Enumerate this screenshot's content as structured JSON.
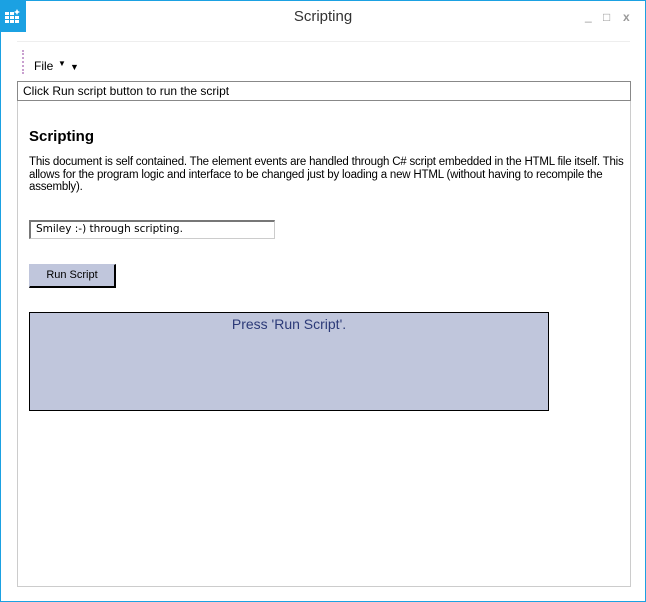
{
  "window": {
    "title": "Scripting",
    "minimize": "_",
    "maximize": "□",
    "close": "x"
  },
  "menu": {
    "file": "File"
  },
  "status": "Click Run script button to run the script",
  "doc": {
    "heading": "Scripting",
    "description": " This document is self contained. The element events are handled through C# script embedded in the HTML file itself. This allows for the program logic and interface to be changed just by loading a new HTML (without having to recompile the assembly).",
    "input_value": "Smiley :-) through scripting.",
    "run_button": "Run Script",
    "output": "Press 'Run Script'."
  }
}
